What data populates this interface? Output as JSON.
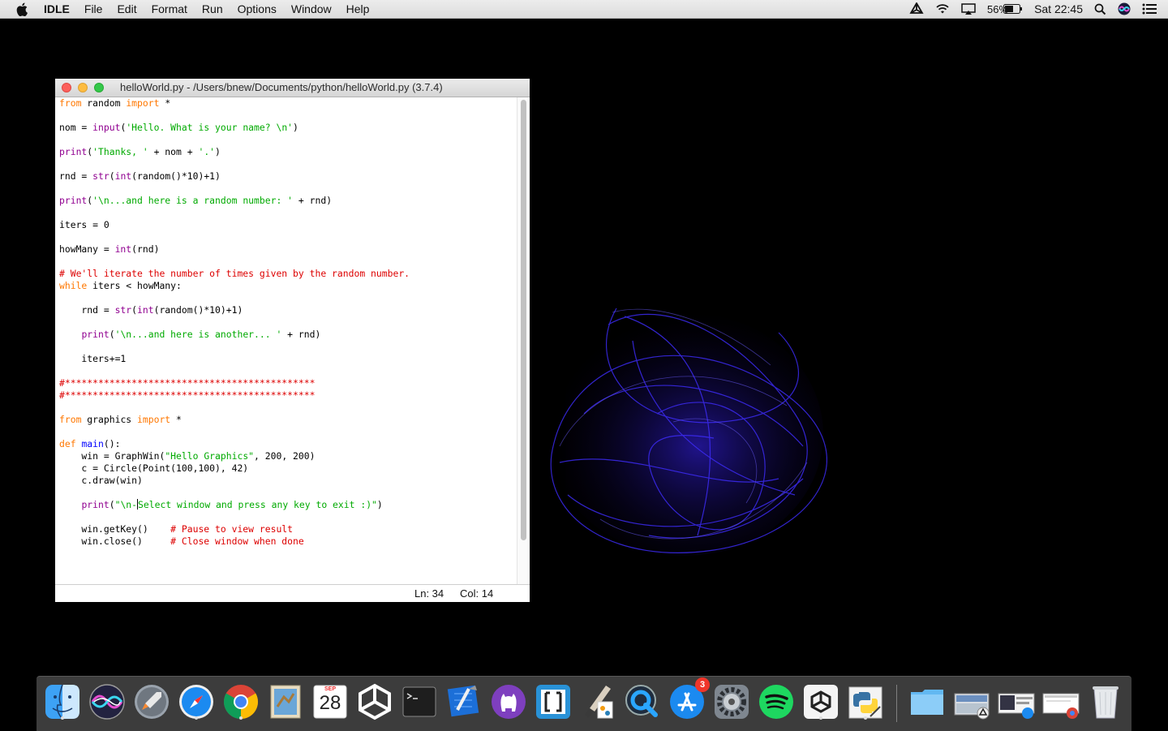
{
  "menubar": {
    "app_name": "IDLE",
    "menus": [
      "File",
      "Edit",
      "Format",
      "Run",
      "Options",
      "Window",
      "Help"
    ],
    "battery_percent": "56%",
    "clock": "Sat 22:45"
  },
  "window": {
    "title": "helloWorld.py - /Users/bnew/Documents/python/helloWorld.py (3.7.4)",
    "status_line": "Ln: 34",
    "status_col": "Col: 14"
  },
  "colors": {
    "keyword": "#ff7700",
    "builtin": "#900090",
    "string": "#00aa00",
    "comment": "#dd0000",
    "definition": "#0000ff"
  },
  "code": {
    "l1": {
      "a": "from",
      "b": " random ",
      "c": "import",
      "d": " *"
    },
    "l3": {
      "a": "nom = ",
      "b": "input",
      "c": "(",
      "d": "'Hello. What is your name? \\n'",
      "e": ")"
    },
    "l5": {
      "a": "print",
      "b": "(",
      "c": "'Thanks, '",
      "d": " + nom + ",
      "e": "'.'",
      "f": ")"
    },
    "l7": {
      "a": "rnd = ",
      "b": "str",
      "c": "(",
      "d": "int",
      "e": "(random()*10)+1)"
    },
    "l9": {
      "a": "print",
      "b": "(",
      "c": "'\\n...and here is a random number: '",
      "d": " + rnd)"
    },
    "l11": {
      "a": "iters = 0"
    },
    "l13": {
      "a": "howMany = ",
      "b": "int",
      "c": "(rnd)"
    },
    "l15": {
      "a": "# We'll iterate the number of times given by the random number."
    },
    "l16": {
      "a": "while",
      "b": " iters < howMany:"
    },
    "l18": {
      "a": "    rnd = ",
      "b": "str",
      "c": "(",
      "d": "int",
      "e": "(random()*10)+1)"
    },
    "l20": {
      "a": "    ",
      "b": "print",
      "c": "(",
      "d": "'\\n...and here is another... '",
      "e": " + rnd)"
    },
    "l22": {
      "a": "    iters+=1"
    },
    "l24": {
      "a": "#*********************************************"
    },
    "l25": {
      "a": "#*********************************************"
    },
    "l27": {
      "a": "from",
      "b": " graphics ",
      "c": "import",
      "d": " *"
    },
    "l29": {
      "a": "def",
      "b": " ",
      "c": "main",
      "d": "():"
    },
    "l30": {
      "a": "    win = GraphWin(",
      "b": "\"Hello Graphics\"",
      "c": ", 200, 200)"
    },
    "l31": {
      "a": "    c = Circle(Point(100,100), 42)"
    },
    "l32": {
      "a": "    c.draw(win)"
    },
    "l34": {
      "a": "    ",
      "b": "print",
      "c": "(",
      "d1": "\"\\n-",
      "d2": "Select window and press any key to exit :)\"",
      "e": ")"
    },
    "l36": {
      "a": "    win.getKey()    ",
      "b": "# Pause to view result"
    },
    "l37": {
      "a": "    win.close()     ",
      "b": "# Close window when done"
    }
  },
  "dock": {
    "items": [
      {
        "name": "Finder",
        "icon": "finder-icon",
        "running": true
      },
      {
        "name": "Siri",
        "icon": "siri-icon",
        "running": false
      },
      {
        "name": "Launchpad",
        "icon": "launchpad-icon",
        "running": false
      },
      {
        "name": "Safari",
        "icon": "safari-icon",
        "running": true
      },
      {
        "name": "Google Chrome",
        "icon": "chrome-icon",
        "running": true
      },
      {
        "name": "Mail",
        "icon": "mail-icon",
        "running": false
      },
      {
        "name": "Calendar",
        "icon": "calendar-icon",
        "running": false
      },
      {
        "name": "Unity",
        "icon": "unity-icon",
        "running": false
      },
      {
        "name": "Terminal",
        "icon": "terminal-icon",
        "running": false
      },
      {
        "name": "Xcode",
        "icon": "xcode-icon",
        "running": false
      },
      {
        "name": "GitHub Desktop",
        "icon": "github-icon",
        "running": false
      },
      {
        "name": "Brackets",
        "icon": "brackets-icon",
        "running": false
      },
      {
        "name": "Paintbrush",
        "icon": "paintbrush-icon",
        "running": false
      },
      {
        "name": "QuickTime Player",
        "icon": "quicktime-icon",
        "running": false
      },
      {
        "name": "App Store",
        "icon": "app-store-icon",
        "running": false
      },
      {
        "name": "System Preferences",
        "icon": "system-preferences-icon",
        "running": false
      },
      {
        "name": "Spotify",
        "icon": "spotify-icon",
        "running": false
      },
      {
        "name": "Unity Hub",
        "icon": "unity-hub-icon",
        "running": true
      },
      {
        "name": "IDLE",
        "icon": "python-idle-icon",
        "running": true
      }
    ],
    "calendar_month": "SEP",
    "calendar_day": "28",
    "app_store_badge": "3"
  }
}
